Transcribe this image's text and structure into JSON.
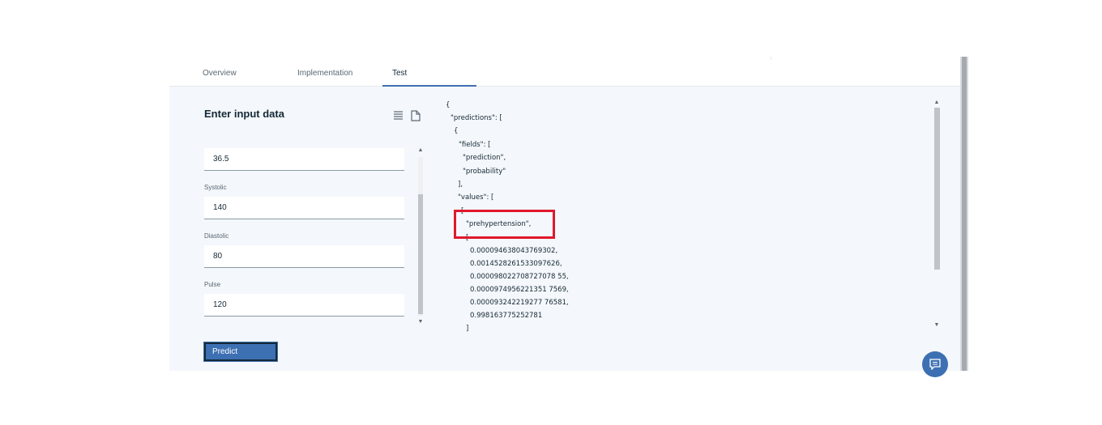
{
  "tabs": [
    {
      "label": "Overview",
      "active": false
    },
    {
      "label": "Implementation",
      "active": false
    },
    {
      "label": "Test",
      "active": true
    }
  ],
  "form": {
    "title": "Enter input data",
    "fields": [
      {
        "label": "",
        "value": "36.5"
      },
      {
        "label": "Systolic",
        "value": "140"
      },
      {
        "label": "Diastolic",
        "value": "80"
      },
      {
        "label": "Pulse",
        "value": "120"
      }
    ],
    "predict_label": "Predict"
  },
  "icons": {
    "list_view": "list-icon",
    "file_view": "document-icon",
    "chat": "chat-icon"
  },
  "output": {
    "lines": [
      "{",
      "\"predictions\": [",
      "{",
      "\"fields\": [",
      "\"prediction\",",
      "\"probability\"",
      "],",
      "\"values\": [",
      "[",
      "\"prehypertension\",",
      "[",
      "0.000094638043769302,",
      "0.0014528261533097626,",
      "0.000098022708727078 55,",
      "0.0000974956221351 7569,",
      "0.000093242219277 76581,",
      "0.998163775252781",
      "]"
    ]
  },
  "colors": {
    "accent": "#3d70b2",
    "highlight": "#e0182d",
    "panel_bg": "#f4f7fb"
  }
}
